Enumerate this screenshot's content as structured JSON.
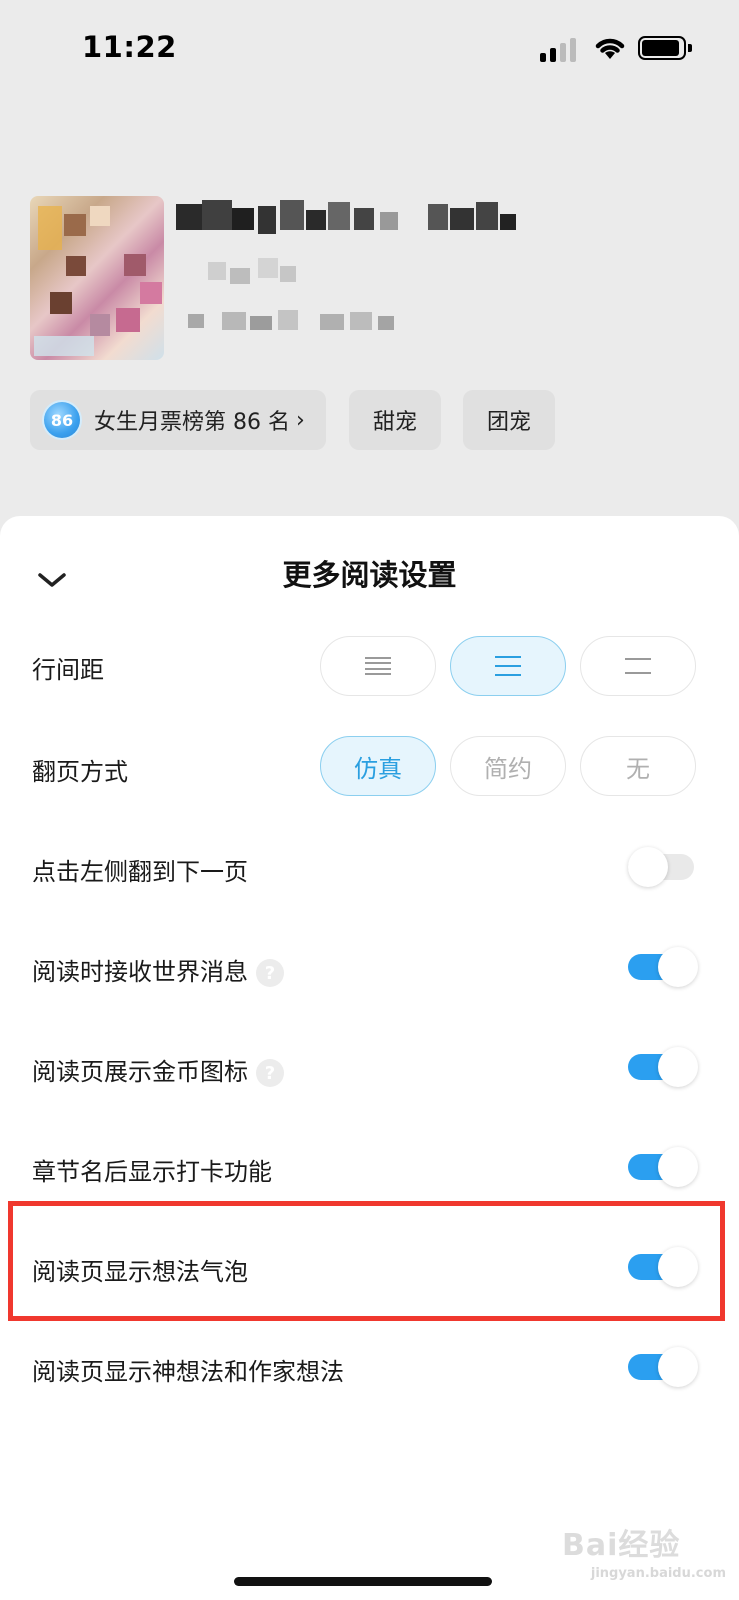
{
  "status_bar": {
    "time": "11:22",
    "signal_icon": "cellular-signal-icon",
    "wifi_icon": "wifi-icon",
    "battery_icon": "battery-icon",
    "battery_level": 0.85
  },
  "book": {
    "cover_icon": "book-cover-image",
    "rank_badge": "86",
    "rank_text": "女生月票榜第 86 名",
    "rank_chevron": "›",
    "tags": [
      "甜宠",
      "团宠"
    ]
  },
  "sheet": {
    "collapse_icon": "chevron-down-icon",
    "title": "更多阅读设置",
    "line_spacing": {
      "label": "行间距",
      "options": [
        "spacing-compact-icon",
        "spacing-medium-icon",
        "spacing-loose-icon"
      ],
      "selected_index": 1
    },
    "page_turn": {
      "label": "翻页方式",
      "options": [
        "仿真",
        "简约",
        "无"
      ],
      "selected_index": 0
    },
    "toggles": [
      {
        "label": "点击左侧翻到下一页",
        "on": false,
        "help": false
      },
      {
        "label": "阅读时接收世界消息",
        "on": true,
        "help": true
      },
      {
        "label": "阅读页展示金币图标",
        "on": true,
        "help": true
      },
      {
        "label": "章节名后显示打卡功能",
        "on": true,
        "help": false
      },
      {
        "label": "阅读页显示想法气泡",
        "on": true,
        "help": false,
        "highlighted": true
      },
      {
        "label": "阅读页显示神想法和作家想法",
        "on": true,
        "help": false
      }
    ],
    "help_glyph": "?"
  },
  "watermark": {
    "logo": "Bai经验",
    "url": "jingyan.baidu.com"
  },
  "colors": {
    "accent": "#2b9ff0",
    "highlight_border": "#f0382e",
    "background": "#ebebeb"
  }
}
